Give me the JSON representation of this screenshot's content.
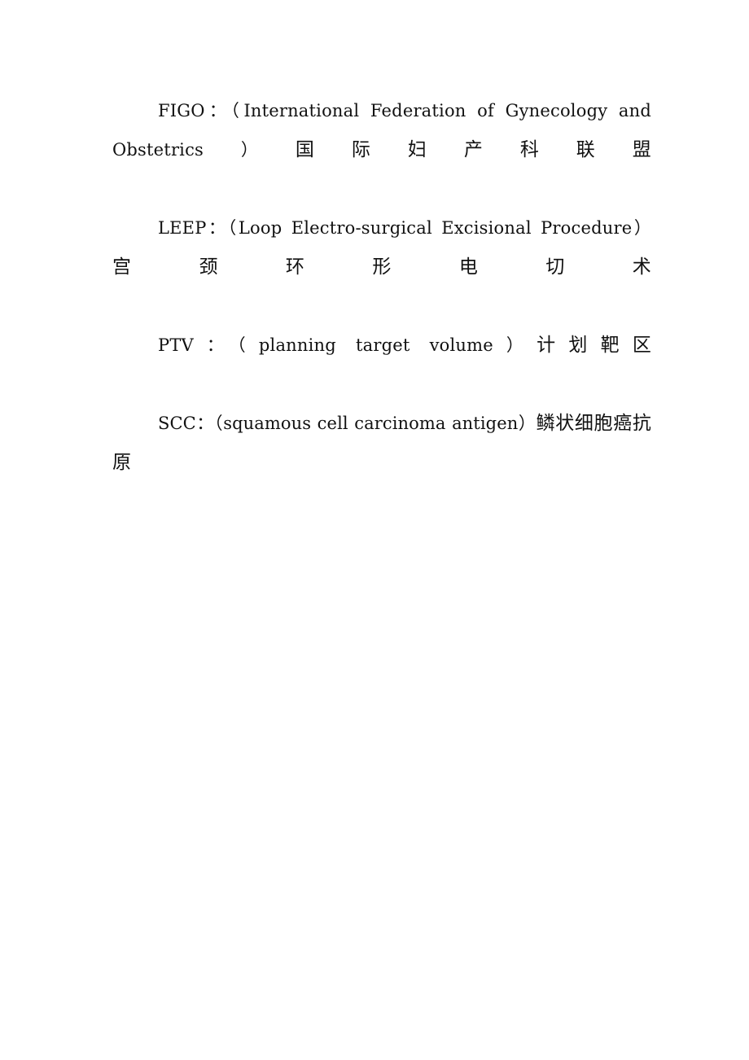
{
  "document": {
    "page_background": "#ffffff",
    "text_color": "#111111",
    "paragraphs": [
      {
        "id": "figo",
        "abbreviation": "FIGO",
        "colon": "：",
        "open_paren": "（",
        "expansion": "International Federation of Gynecology and Obstetrics",
        "close_paren": "）",
        "translation": "国际妇产科联盟",
        "full_text": "FIGO：（International Federation of Gynecology and Obstetrics）国际妇产科联盟"
      },
      {
        "id": "leep",
        "abbreviation": "LEEP",
        "colon": "：",
        "open_paren": "（",
        "expansion": "Loop Electro-surgical Excisional Procedure",
        "close_paren": "）",
        "translation": "宫颈环形电切术",
        "full_text": "LEEP：（Loop Electro-surgical Excisional Procedure）宫颈环形电切术"
      },
      {
        "id": "ptv",
        "abbreviation": "PTV",
        "colon": "：",
        "open_paren": "（",
        "expansion": "planning target volume",
        "close_paren": "）",
        "translation": "计划靶区",
        "full_text": "PTV：（planning target volume）计划靶区"
      },
      {
        "id": "scc",
        "abbreviation": "SCC",
        "colon": "：",
        "open_paren": "（",
        "expansion": "squamous cell carcinoma antigen",
        "close_paren": "）",
        "translation": "鳞状细胞癌抗原",
        "full_text": "SCC：（squamous cell carcinoma antigen）鳞状细胞癌抗原"
      }
    ]
  }
}
